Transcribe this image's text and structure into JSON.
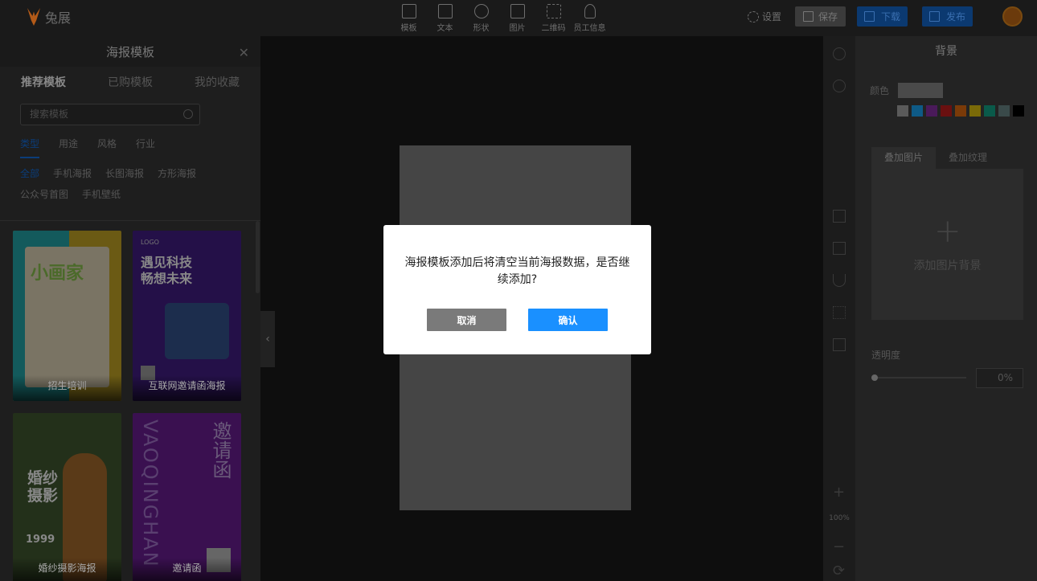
{
  "app": {
    "logo_text": "兔展"
  },
  "toolbar": {
    "tools": [
      {
        "label": "模板",
        "icon": "template-icon"
      },
      {
        "label": "文本",
        "icon": "text-icon"
      },
      {
        "label": "形状",
        "icon": "shape-icon"
      },
      {
        "label": "图片",
        "icon": "image-icon"
      },
      {
        "label": "二维码",
        "icon": "qrcode-icon"
      },
      {
        "label": "员工信息",
        "icon": "staff-icon"
      }
    ],
    "settings_label": "设置",
    "save_label": "保存",
    "download_label": "下载",
    "publish_label": "发布"
  },
  "left_panel": {
    "title": "海报模板",
    "tabs": [
      "推荐模板",
      "已购模板",
      "我的收藏"
    ],
    "search_placeholder": "搜索模板",
    "categories": [
      "类型",
      "用途",
      "风格",
      "行业"
    ],
    "subcategories": [
      "全部",
      "手机海报",
      "长图海报",
      "方形海报",
      "公众号首图",
      "手机壁纸"
    ],
    "cards": [
      {
        "caption": "招生培训",
        "art_text": "小画家"
      },
      {
        "caption": "互联网邀请函海报",
        "art_logo": "LOGO",
        "art_text_1": "遇见科技",
        "art_text_2": "畅想未来"
      },
      {
        "caption": "婚纱摄影海报",
        "art_text_1": "婚纱",
        "art_text_2": "摄影",
        "price": "1999"
      },
      {
        "caption": "邀请函",
        "art_vertical": "VAOQINGHAN",
        "art_cn": "邀请函"
      }
    ]
  },
  "right_panel": {
    "title": "背景",
    "color_label": "颜色",
    "swatch_colors": [
      "#5a5a5a",
      "#0e5a86",
      "#4a1a5a",
      "#6a1010",
      "#7a3a08",
      "#7a6a08",
      "#0a5a4a",
      "#3a4a4a",
      "#000000"
    ],
    "bg_tabs": [
      "叠加图片",
      "叠加纹理"
    ],
    "add_bg_label": "添加图片背景",
    "opacity_label": "透明度",
    "opacity_value": "0%",
    "opacity_fraction": 0
  },
  "canvas": {
    "zoom_label": "100%"
  },
  "modal": {
    "message": "海报模板添加后将清空当前海报数据，是否继续添加?",
    "cancel_label": "取消",
    "confirm_label": "确认"
  }
}
